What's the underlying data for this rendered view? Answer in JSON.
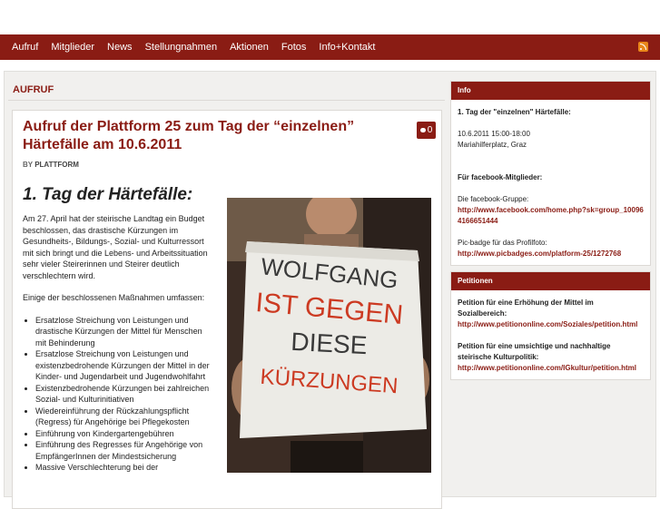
{
  "nav": {
    "items": [
      "Aufruf",
      "Mitglieder",
      "News",
      "Stellungnahmen",
      "Aktionen",
      "Fotos",
      "Info+Kontakt"
    ],
    "rss_icon": "rss-icon"
  },
  "main": {
    "section_label": "AUFRUF",
    "post": {
      "title": "Aufruf der Plattform 25 zum Tag der “einzelnen” Härtefälle am 10.6.2011",
      "comment_count": "0",
      "byline_prefix": "BY",
      "byline_author": "PLATTFORM",
      "heading": "1. Tag der Härtefälle:",
      "intro": "Am 27. April hat der steirische Landtag ein Budget beschlossen, das drastische Kürzungen im Gesundheits-, Bildungs-, Sozial- und Kulturressort mit sich bringt und die Lebens- und Arbeitssituation sehr vieler Steirerinnen und Steirer deutlich verschlechtern wird.",
      "measures_intro": "Einige der beschlossenen Maßnahmen umfassen:",
      "measures": [
        "Ersatzlose Streichung von Leistungen und drastische Kürzungen der Mittel für Menschen mit Behinderung",
        "Ersatzlose Streichung von Leistungen und existenzbedrohende Kürzungen der Mittel in der Kinder- und Jugendarbeit und Jugendwohlfahrt",
        "Existenzbedrohende Kürzungen bei zahlreichen Sozial- und Kulturinitiativen",
        "Wiedereinführung der Rückzahlungspflicht (Regress) für Angehörige bei Pflegekosten",
        "Einführung von Kindergartengebühren",
        "Einführung des Regresses für Angehörige von EmpfängerInnen der Mindestsicherung",
        "Massive Verschlechterung bei der"
      ],
      "photo_sign": [
        "WOLFGANG",
        "IST GEGEN",
        "DIESE",
        "KÜRZUNGEN"
      ]
    }
  },
  "sidebar": {
    "info": {
      "title": "Info",
      "heading": "1. Tag der \"einzelnen\" Härtefälle:",
      "date": "10.6.2011 15:00-18:00",
      "place": "Mariahilferplatz, Graz",
      "fb_heading": "Für facebook-Mitglieder:",
      "fb_group_label": "Die facebook-Gruppe:",
      "fb_group_link": "http://www.facebook.com/home.php?sk=group_100964166651444",
      "pic_label": "Pic-badge für das Profilfoto:",
      "pic_link": "http://www.picbadges.com/platform-25/1272768"
    },
    "petitions": {
      "title": "Petitionen",
      "p1_heading": "Petition für eine Erhöhung der Mittel im Sozialbereich:",
      "p1_link": "http://www.petitiononline.com/Soziales/petition.html",
      "p2_heading": "Petition für eine umsichtige und nachhaltige steirische Kulturpolitik:",
      "p2_link": "http://www.petitiononline.com/IGkultur/petition.html"
    }
  }
}
